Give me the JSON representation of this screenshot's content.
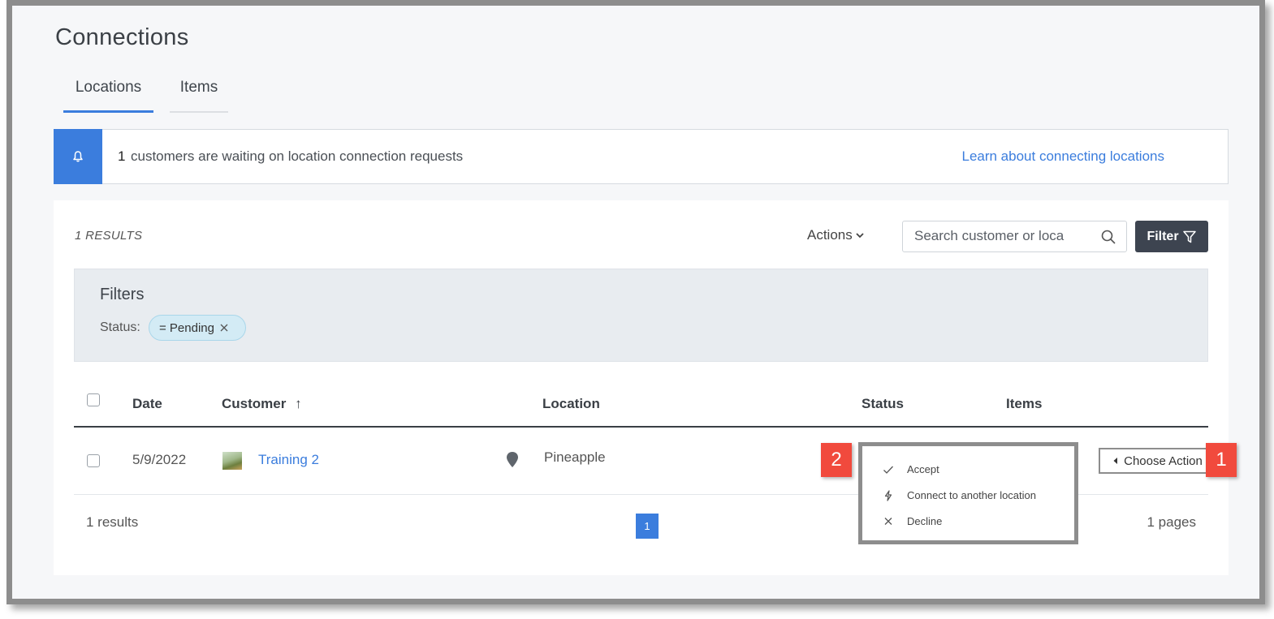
{
  "page": {
    "title": "Connections"
  },
  "tabs": [
    {
      "label": "Locations",
      "active": true
    },
    {
      "label": "Items",
      "active": false
    }
  ],
  "alert": {
    "icon": "bell-icon",
    "count": "1",
    "message": "customers are waiting on location connection requests",
    "link_label": "Learn about connecting locations"
  },
  "toolbar": {
    "results_label": "1 RESULTS",
    "actions_label": "Actions",
    "search_placeholder": "Search customer or loca",
    "filter_label": "Filter"
  },
  "filters": {
    "title": "Filters",
    "status_label": "Status:",
    "chip_label": "= Pending"
  },
  "table": {
    "columns": [
      "Date",
      "Customer",
      "Location",
      "Status",
      "Items"
    ],
    "sort_indicator": "↑",
    "rows": [
      {
        "date": "5/9/2022",
        "customer": "Training 2",
        "location": "Pineapple",
        "status": "",
        "items": ""
      }
    ],
    "row_action_label": "Choose Action"
  },
  "action_menu": {
    "items": [
      {
        "label": "Accept",
        "icon": "check-icon"
      },
      {
        "label": "Connect to another location",
        "icon": "bolt-icon"
      },
      {
        "label": "Decline",
        "icon": "close-icon"
      }
    ]
  },
  "callouts": {
    "first": "1",
    "second": "2"
  },
  "footer": {
    "results_text": "1 results",
    "current_page": "1",
    "pages_text": "1 pages"
  },
  "colors": {
    "accent": "#3b7ddd",
    "filter_button": "#3d4450",
    "callout": "#f14a3d",
    "chip": "#d3ebf5"
  }
}
